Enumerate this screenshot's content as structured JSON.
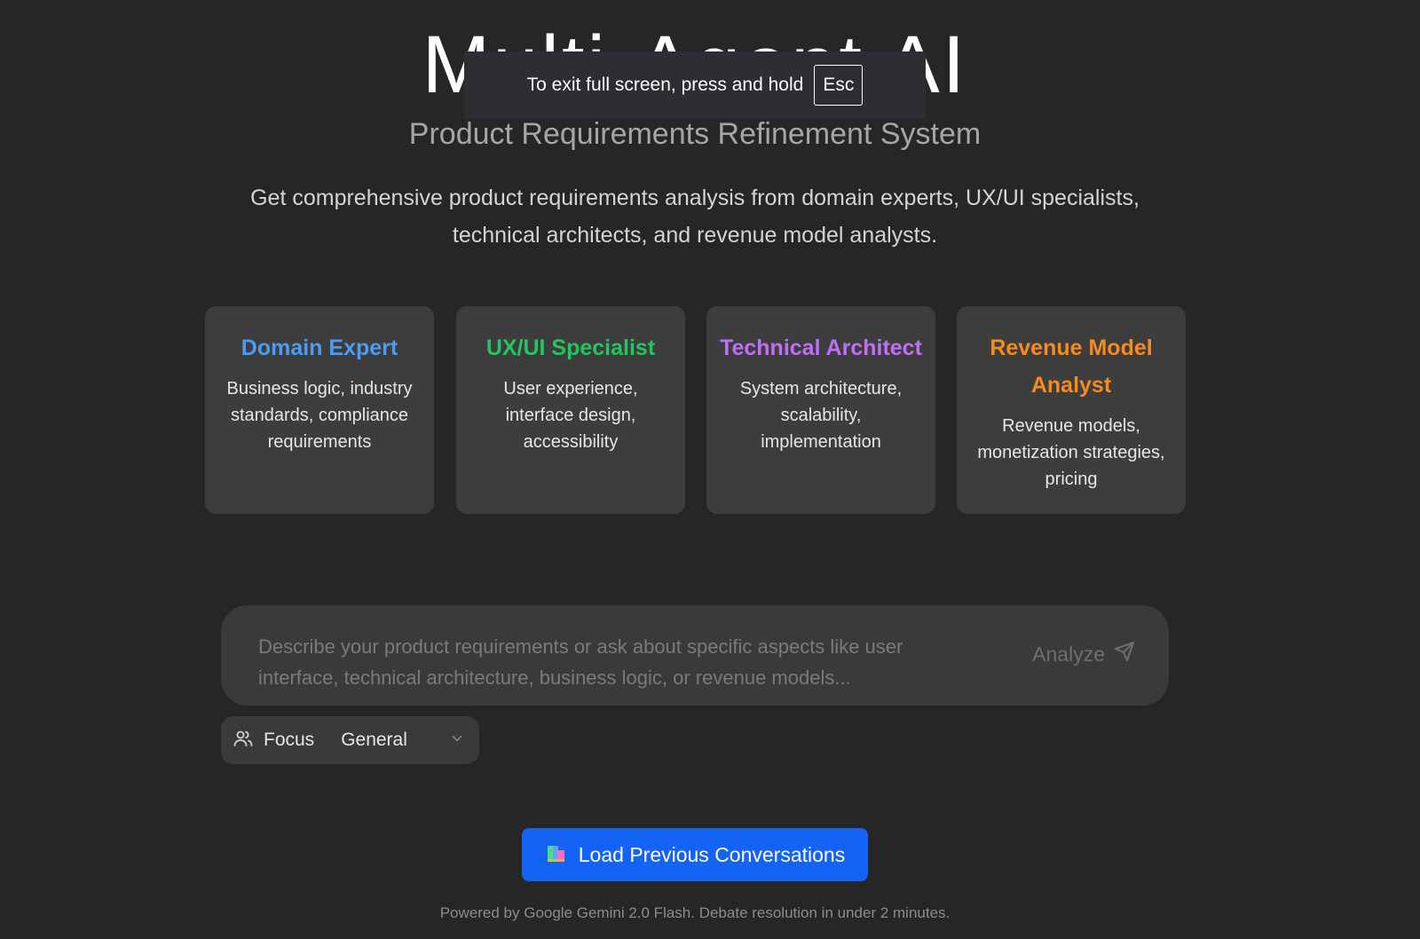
{
  "header": {
    "title": "Multi-Agent AI",
    "subtitle": "Product Requirements Refinement System",
    "description": "Get comprehensive product requirements analysis from domain experts, UX/UI specialists, technical architects, and revenue model analysts."
  },
  "fullscreen_notice": {
    "text": "To exit full screen, press and hold",
    "key": "Esc"
  },
  "agents": [
    {
      "title": "Domain Expert",
      "description": "Business logic, industry standards, compliance requirements",
      "color": "#4a9cf5"
    },
    {
      "title": "UX/UI Specialist",
      "description": "User experience, interface design, accessibility",
      "color": "#22c55e"
    },
    {
      "title": "Technical Architect",
      "description": "System architecture, scalability, implementation",
      "color": "#c06ef5"
    },
    {
      "title": "Revenue Model Analyst",
      "description": "Revenue models, monetization strategies, pricing",
      "color": "#f58a1f"
    }
  ],
  "composer": {
    "placeholder": "Describe your product requirements or ask about specific aspects like user interface, technical architecture, business logic, or revenue models...",
    "value": "",
    "submit_label": "Analyze",
    "submit_icon": "send-icon"
  },
  "focus": {
    "icon": "users-icon",
    "label": "Focus",
    "selected": "General"
  },
  "load_conversations": {
    "icon": "books-icon",
    "label": "Load Previous Conversations"
  },
  "footer": {
    "note": "Powered by Google Gemini 2.0 Flash. Debate resolution in under 2 minutes."
  },
  "colors": {
    "background": "#262626",
    "card": "#3d3d3d",
    "primary_button": "#1463f5"
  }
}
